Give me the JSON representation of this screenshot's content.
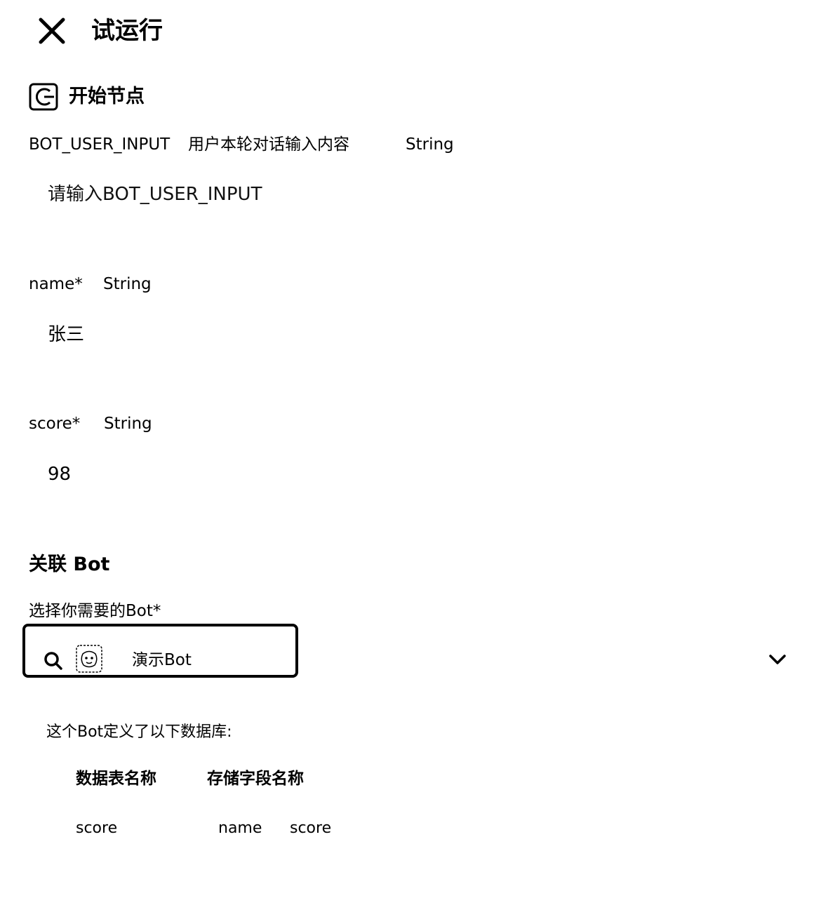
{
  "header": {
    "title": "试运行",
    "close_icon": "close-icon"
  },
  "start_node": {
    "title": "开始节点",
    "icon": "start-node-icon"
  },
  "fields": {
    "bot_user_input": {
      "name": "BOT_USER_INPUT",
      "description": "用户本轮对话输入内容",
      "type": "String",
      "value": "",
      "placeholder": "请输入BOT_USER_INPUT"
    },
    "name": {
      "label": "name*",
      "type": "String",
      "value": "张三"
    },
    "score": {
      "label": "score*",
      "type": "String",
      "value": "98"
    }
  },
  "bot_section": {
    "title": "关联 Bot",
    "select_label": "选择你需要的Bot*",
    "selected_bot": "演示Bot",
    "search_icon": "search-icon",
    "avatar_icon": "bot-avatar-icon",
    "dropdown_icon": "chevron-down-icon"
  },
  "database": {
    "intro": "这个Bot定义了以下数据库:",
    "columns": [
      "数据表名称",
      "存储字段名称"
    ],
    "rows": [
      {
        "table": "score",
        "fields": [
          "name",
          "score"
        ]
      }
    ]
  }
}
